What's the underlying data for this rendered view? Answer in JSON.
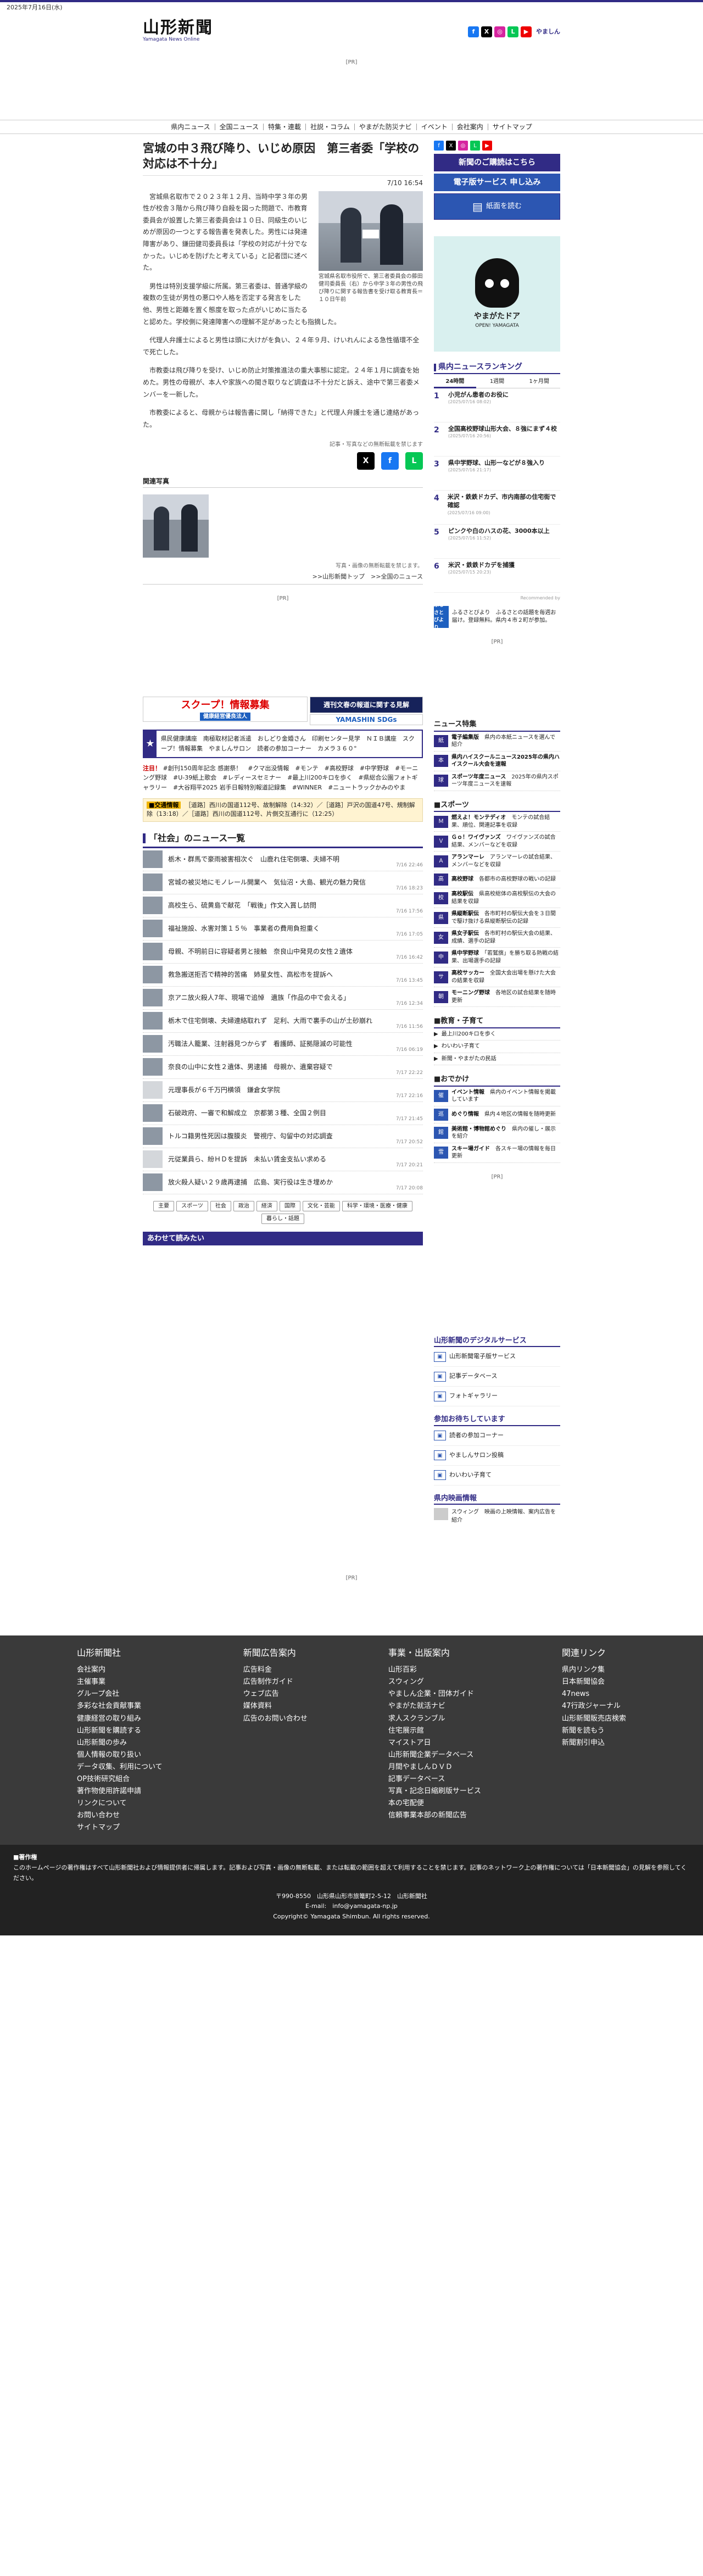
{
  "date": "2025年7月16日(水)",
  "brand": {
    "logo": "山形新聞",
    "sub": "Yamagata News Online",
    "yamashin": "やましん"
  },
  "ad_label": "[PR]",
  "nav": [
    "県内ニュース",
    "全国ニュース",
    "特集・連載",
    "社説・コラム",
    "やまがた防災ナビ",
    "イベント",
    "会社案内",
    "サイトマップ"
  ],
  "article": {
    "title": "宮城の中３飛び降り、いじめ原因　第三者委「学校の対応は不十分」",
    "date": "7/10 16:54",
    "photo_caption": "宮城県名取市役所で、第三者委員会の藤田健司委員長（右）から中学３年の男性の飛び降りに関する報告書を受け取る教育長＝１０日午前",
    "paragraphs": [
      "宮城県名取市で２０２３年１２月、当時中学３年の男性が校舎３階から飛び降り自殺を図った問題で、市教育委員会が設置した第三者委員会は１０日、同級生のいじめが原因の一つとする報告書を発表した。男性には発達障害があり、鎌田健司委員長は「学校の対応が十分でなかった。いじめを防げたと考えている」と記者団に述べた。",
      "男性は特別支援学級に所属。第三者委は、普通学級の複数の生徒が男性の悪口や人格を否定する発言をした他、男性と距離を置く態度を取った点がいじめに当たると認めた。学校側に発達障害への理解不足があったとも指摘した。",
      "代理人弁護士によると男性は頭に大けがを負い、２４年９月、けいれんによる急性循環不全で死亡した。",
      "市教委は飛び降りを受け、いじめ防止対策推進法の重大事態に認定。２４年１月に調査を始めた。男性の母親が、本人や家族への聞き取りなど調査は不十分だと訴え、途中で第三者委メンバーを一新した。",
      "市教委によると、母親からは報告書に関し「納得できた」と代理人弁護士を通じ連絡があった。"
    ],
    "share_note": "記事・写真などの無断転載を禁じます",
    "related_heading": "関連写真",
    "related_note": "写真・画像の無断転載を禁じます。",
    "backlinks": ">>山形新聞トップ　>>全国のニュース"
  },
  "banners": {
    "scoop": "スクープ！情報募集",
    "scoop_sub": "健康経営優良法人",
    "shukan": "週刊文春の報道に関する見解",
    "sdgs": "YAMASHIN SDGs"
  },
  "info_links": "県民健康講座　南極取材記者派遣　おしどり金婚さん　印刷センター見学　ＮＩＢ講座　スクープ！情報募集　やましんサロン　読者の参加コーナー　カメラ３６０°",
  "hot_label": "注目！",
  "hot_tags": "#創刊150周年記念 感謝祭！　#クマ出没情報　#モンテ　#高校野球　#中学野球　#モーニング野球　#U-39紙上歌会　#レディースセミナー　#最上川200キロを歩く　#県総合公園フォトギャラリー　#大谷翔平2025 岩手日報特別報道記録集　#WINNER　#ニュートラックかみのやま",
  "traffic": {
    "label": "■交通情報",
    "text": "［道路］西川の国道112号、故制解除（14:32）／［道路］戸沢の国道47号、規制解除（13:18）／［道路］西川の国道112号、片側交互通行に（12:25）"
  },
  "social_heading": "「社会」のニュース一覧",
  "news": [
    {
      "t": "栃木・群馬で豪雨被害相次ぐ　山鹿れ住宅倒壊、夫婦不明",
      "d": "7/16 22:46",
      "g": false
    },
    {
      "t": "宮城の被災地にモノレール開業へ　気仙沼・大島、観光の魅力発信",
      "d": "7/16 18:23",
      "g": false
    },
    {
      "t": "高校生ら、硫黄島で献花　「戦後」作文入賞し訪問",
      "d": "7/16 17:56",
      "g": false
    },
    {
      "t": "福祉施設、水害対策１５％　事業者の費用負担重く",
      "d": "7/16 17:05",
      "g": false
    },
    {
      "t": "母親、不明前日に容疑者男と接触　奈良山中発見の女性２遺体",
      "d": "7/16 16:42",
      "g": false
    },
    {
      "t": "救急搬送拒否で精神的苦痛　姉星女性、高松市を提訴へ",
      "d": "7/16 13:45",
      "g": false
    },
    {
      "t": "京アニ放火殺人7年、現場で追悼　遺族「作品の中で会える」",
      "d": "7/16 12:34",
      "g": false
    },
    {
      "t": "栃木で住宅倒壊、夫婦連絡取れず　足利、大雨で裏手の山が土砂崩れ",
      "d": "7/16 11:56",
      "g": false
    },
    {
      "t": "汚職法人籠業、注射器見つからず　看護師、証拠隠滅の可能性",
      "d": "7/16 06:19",
      "g": false
    },
    {
      "t": "奈良の山中に女性２遺体、男逮捕　母親か、遺棄容疑で",
      "d": "7/17 22:22",
      "g": false
    },
    {
      "t": "元理事長が６千万円横領　鎌倉女学院",
      "d": "7/17 22:16",
      "g": true
    },
    {
      "t": "石破政府、一審で和解成立　京都第３種、全国２例目",
      "d": "7/17 21:45",
      "g": false
    },
    {
      "t": "トルコ籍男性死因は腹膜炎　警視庁、勾留中の対応調査",
      "d": "7/17 20:52",
      "g": false
    },
    {
      "t": "元従業員ら、紛ＨＤを提訴　未払い賃金支払い求める",
      "d": "7/17 20:21",
      "g": true
    },
    {
      "t": "放火殺人疑い２９歳再逮捕　広島、実行役は生き埋めか",
      "d": "7/17 20:08",
      "g": false
    }
  ],
  "categories": [
    "主要",
    "スポーツ",
    "社会",
    "政治",
    "経済",
    "国際",
    "文化・芸能",
    "科学・環境・医療・健康",
    "暮らし・話題"
  ],
  "awase": "あわせて読みたい",
  "recommended": "Recommended by",
  "side": {
    "buttons": [
      "新聞のご購読はこちら",
      "電子版サービス 申し込み",
      "紙面を読む"
    ],
    "doa_title": "やまがたドア",
    "doa_sub": "OPEN! YAMAGATA",
    "ranking_title": "県内ニュースランキング",
    "rank_tabs": [
      "24時間",
      "1週間",
      "1ヶ月間"
    ],
    "ranking": [
      {
        "n": "1",
        "t": "小児がん患者のお役に",
        "d": "(2025/07/16 08:02)"
      },
      {
        "n": "2",
        "t": "全国高校野球山形大会、８強にまず４校",
        "d": "(2025/07/16 20:56)"
      },
      {
        "n": "3",
        "t": "県中学野球、山形一などが８強入り",
        "d": "(2025/07/16 21:17)"
      },
      {
        "n": "4",
        "t": "米沢・鉄鉄ドカデ、市内南部の住宅街で確認",
        "d": "(2025/07/16 09:00)"
      },
      {
        "n": "5",
        "t": "ピンクや白のハスの花、3000本以上",
        "d": "(2025/07/16 11:52)"
      },
      {
        "n": "6",
        "t": "米沢・鉄鉄ドカデを捕獲",
        "d": "(2025/07/15 20:23)"
      }
    ],
    "furusato_logo": "ふるさとびより",
    "furusato_text": "ふるさとびより　ふるさとの話題を毎週お届け。登録無料。県内４市２町が参加。",
    "special_title": "ニュース特集",
    "specials": [
      {
        "i": "紙",
        "b": "電子編集版",
        "t": "県内の本紙ニュースを選んで紹介"
      },
      {
        "i": "本",
        "b": "県内ハイスクールニュース2025年の県内ハイスクール大会を速報",
        "t": ""
      },
      {
        "i": "球",
        "b": "スポーツ年度ニュース",
        "t": "2025年の県内スポーツ年度ニュースを速報"
      }
    ],
    "sports_title": "■スポーツ",
    "sports": [
      {
        "i": "Ｍ",
        "b": "燃えよ！モンテディオ",
        "t": "モンテの試合結果、順位、関連記事を収録"
      },
      {
        "i": "Ｖ",
        "b": "Ｇｏ！ワイヴァンズ",
        "t": "ワイヴァンズの試合結果、メンバーなどを収録"
      },
      {
        "i": "Ａ",
        "b": "アランマーレ",
        "t": "アランマーレの試合結果、メンバーなどを収録"
      },
      {
        "i": "高",
        "b": "高校野球",
        "t": "各都市の高校野球の戦いの記録"
      },
      {
        "i": "校",
        "b": "高校駅伝",
        "t": "県高校総体の高校駅伝の大会の結果を収録"
      },
      {
        "i": "県",
        "b": "県縦断駅伝",
        "t": "各市町村の駅伝大会を３日間で駆け抜ける県縦断駅伝の記録"
      },
      {
        "i": "女",
        "b": "県女子駅伝",
        "t": "各市町村の駅伝大会の結果、成績、選手の記録"
      },
      {
        "i": "中",
        "b": "県中学野球",
        "t": "「若鷲旗」を勝ち取る熱戦の結果、出場選手の記録"
      },
      {
        "i": "サ",
        "b": "高校サッカー",
        "t": "全国大会出場を懸けた大会の結果を収録"
      },
      {
        "i": "朝",
        "b": "モーニング野球",
        "t": "各地区の試合結果を随時更新"
      }
    ],
    "edu_title": "■教育・子育て",
    "edu": [
      "最上川200キロを歩く",
      "わいわい子育て",
      "新聞・やまがたの民話"
    ],
    "outing_title": "■おでかけ",
    "outing": [
      {
        "i": "催",
        "b": "イベント情報",
        "t": "県内のイベント情報を掲載しています"
      },
      {
        "i": "巡",
        "b": "めぐり情報",
        "t": "県内４地区の情報を随時更新"
      },
      {
        "i": "館",
        "b": "美術館・博物館めぐり",
        "t": "県内の催し・展示を紹介"
      },
      {
        "i": "雪",
        "b": "スキー場ガイド",
        "t": "各スキー場の情報を毎日更新"
      }
    ],
    "digital_title": "山形新聞のデジタルサービス",
    "digital": [
      "山形新聞電子版サービス",
      "記事データベース",
      "フォトギャラリー"
    ],
    "join_title": "参加お待ちしています",
    "join": [
      "読者の参加コーナー",
      "やましんサロン投稿",
      "わいわい子育て"
    ],
    "film_title": "県内映画情報",
    "film": "スウィング　映画の上映情報、案内広告を紹介"
  },
  "footer": {
    "cols": [
      {
        "h": "山形新聞社",
        "items": [
          "会社案内",
          "主催事業",
          "グループ会社",
          "多彩な社会貢献事業",
          "健康経営の取り組み",
          "山形新聞を購読する",
          "山形新聞の歩み",
          "個人情報の取り扱い",
          "データ収集、利用について",
          "OP技術研究組合",
          "著作物使用許諾申請",
          "リンクについて",
          "お問い合わせ",
          "サイトマップ"
        ]
      },
      {
        "h": "新聞広告案内",
        "items": [
          "広告料金",
          "広告制作ガイド",
          "ウェブ広告",
          "媒体資料",
          "広告のお問い合わせ"
        ]
      },
      {
        "h": "事業・出版案内",
        "items": [
          "山形百彩",
          "スウィング",
          "やましん企業・団体ガイド",
          "やまがた就活ナビ",
          "求人スクランブル",
          "住宅展示館",
          "マイストア日",
          "山形新聞企業データベース",
          "月間やましんＤＶＤ",
          "記事データベース",
          "写真・記念日縮刷版サービス",
          "本の宅配便",
          "信頼事業本部の新聞広告"
        ]
      },
      {
        "h": "関連リンク",
        "items": [
          "県内リンク集",
          "日本新聞協会",
          "47news",
          "47行政ジャーナル",
          "山形新聞販売店検索",
          "新聞を読もう",
          "新聞割引申込"
        ]
      }
    ],
    "note_h": "■著作権",
    "note": "このホームページの著作権はすべて山形新聞社および情報提供者に帰属します。記事および写真・画像の無断転載、または転載の範囲を超えて利用することを禁じます。記事のネットワーク上の著作権については「日本新聞協会」の見解を参照してください。",
    "address": "〒990-8550　山形県山形市旅篭町2-5-12　山形新聞社",
    "email": "E-mail:　info@yamagata-np.jp",
    "copyright": "Copyright© Yamagata Shimbun. All rights reserved."
  }
}
